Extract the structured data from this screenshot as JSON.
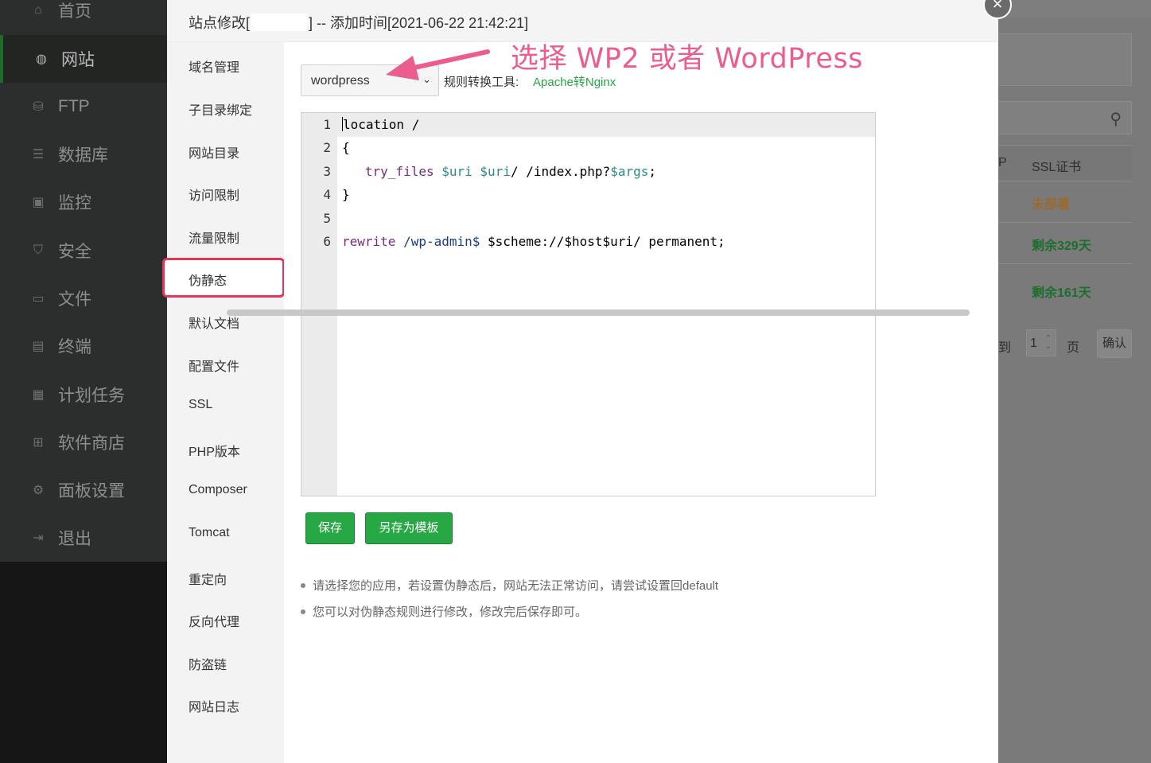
{
  "main_nav": [
    {
      "label": "首页",
      "icon": "home-icon",
      "glyph": "⌂"
    },
    {
      "label": "网站",
      "icon": "globe-icon",
      "glyph": "◍"
    },
    {
      "label": "FTP",
      "icon": "ftp-icon",
      "glyph": "⛁"
    },
    {
      "label": "数据库",
      "icon": "database-icon",
      "glyph": "☰"
    },
    {
      "label": "监控",
      "icon": "monitor-icon",
      "glyph": "▣"
    },
    {
      "label": "安全",
      "icon": "shield-icon",
      "glyph": "⛉"
    },
    {
      "label": "文件",
      "icon": "folder-icon",
      "glyph": "▭"
    },
    {
      "label": "终端",
      "icon": "terminal-icon",
      "glyph": "▤"
    },
    {
      "label": "计划任务",
      "icon": "calendar-icon",
      "glyph": "▦"
    },
    {
      "label": "软件商店",
      "icon": "apps-icon",
      "glyph": "⊞"
    },
    {
      "label": "面板设置",
      "icon": "gear-icon",
      "glyph": "⚙"
    },
    {
      "label": "退出",
      "icon": "logout-icon",
      "glyph": "⇥"
    }
  ],
  "modal": {
    "title_prefix": "站点修改[",
    "title_suffix": "] -- 添加时间[2021-06-22 21:42:21]",
    "close": "×"
  },
  "modal_side": [
    "域名管理",
    "子目录绑定",
    "网站目录",
    "访问限制",
    "流量限制",
    "伪静态",
    "默认文档",
    "配置文件",
    "SSL",
    "PHP版本",
    "Composer",
    "Tomcat",
    "重定向",
    "反向代理",
    "防盗链",
    "网站日志"
  ],
  "rewrite": {
    "selected": "wordpress",
    "tool_label": "规则转换工具:",
    "tool_link": "Apache转Nginx",
    "annotation": "选择 WP2 或者 WordPress",
    "line_numbers": [
      "1",
      "2",
      "3",
      "4",
      "5",
      "6"
    ],
    "code": {
      "l1": "location /",
      "l2": "{",
      "l3_kw": "try_files",
      "l3_v1": "$uri",
      "l3_v2": "$uri",
      "l3_mid": "/ /index.php?",
      "l3_v3": "$args",
      "l3_end": ";",
      "l4": "}",
      "l6_kw": "rewrite",
      "l6_path": "/wp-admin$",
      "l6_rest": " $scheme://$host$uri/ permanent;"
    },
    "save_label": "保存",
    "save_template_label": "另存为模板",
    "tips": [
      "请选择您的应用，若设置伪静态后，网站无法正常访问，请尝试设置回default",
      "您可以对伪静态规则进行修改，修改完后保存即可。"
    ]
  },
  "background_page": {
    "col_p": "P",
    "col_ssl": "SSL证书",
    "rows": [
      {
        "ssl": "未部署",
        "color": "#9a6a2c"
      },
      {
        "ssl": "剩余329天",
        "color": "#1c6e2d"
      },
      {
        "ssl": "剩余161天",
        "color": "#1c6e2d"
      }
    ],
    "goto": "转到",
    "page_value": "1",
    "page_unit": "页",
    "confirm": "确认"
  }
}
